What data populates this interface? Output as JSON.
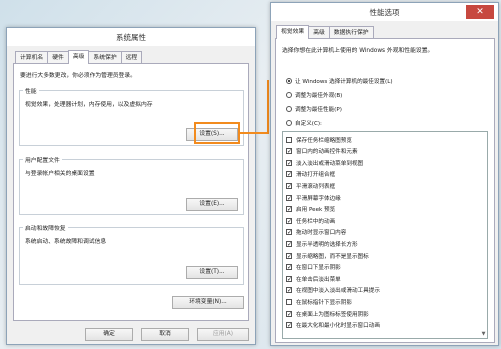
{
  "left_window": {
    "title": "系统属性",
    "tabs": [
      "计算机名",
      "硬件",
      "高级",
      "系统保护",
      "远程"
    ],
    "active_tab": "高级",
    "notice": "要进行大多数更改，你必须作为管理员登录。",
    "performance": {
      "title": "性能",
      "desc": "视觉效果，处理器计划，内存使用，以及虚拟内存",
      "button": "设置(S)..."
    },
    "user_profiles": {
      "title": "用户配置文件",
      "desc": "与登录帐户相关的桌面设置",
      "button": "设置(E)..."
    },
    "startup": {
      "title": "启动和故障恢复",
      "desc": "系统启动、系统故障和调试信息",
      "button": "设置(T)..."
    },
    "env_button": "环境变量(N)...",
    "ok": "确定",
    "cancel": "取消",
    "apply": "应用(A)"
  },
  "right_window": {
    "title": "性能选项",
    "tabs": [
      "视觉效果",
      "高级",
      "数据执行保护"
    ],
    "active_tab": "视觉效果",
    "intro": "选择你想在此计算机上使用的 Windows 外观和性能设置。",
    "radios": [
      {
        "label": "让 Windows 选择计算机的最佳设置(L)",
        "selected": true
      },
      {
        "label": "调整为最佳外观(B)",
        "selected": false
      },
      {
        "label": "调整为最佳性能(P)",
        "selected": false
      },
      {
        "label": "自定义(C):",
        "selected": false
      }
    ],
    "checks": [
      {
        "label": "保存任务栏缩略图预览",
        "checked": false
      },
      {
        "label": "窗口内的动画控件和元素",
        "checked": true
      },
      {
        "label": "淡入淡出或滑动菜单到视图",
        "checked": true
      },
      {
        "label": "滑动打开组合框",
        "checked": true
      },
      {
        "label": "平滑滚动列表框",
        "checked": true
      },
      {
        "label": "平滑屏幕字体边缘",
        "checked": true
      },
      {
        "label": "启用 Peek 预览",
        "checked": true
      },
      {
        "label": "任务栏中的动画",
        "checked": true
      },
      {
        "label": "拖动时显示窗口内容",
        "checked": true
      },
      {
        "label": "显示半透明的选择长方形",
        "checked": true
      },
      {
        "label": "显示缩略图，而不是显示图标",
        "checked": true
      },
      {
        "label": "在窗口下显示阴影",
        "checked": true
      },
      {
        "label": "在单击后淡出菜单",
        "checked": true
      },
      {
        "label": "在视图中淡入淡出或滑动工具提示",
        "checked": true
      },
      {
        "label": "在鼠标指针下显示阴影",
        "checked": false
      },
      {
        "label": "在桌面上为图标标签使用阴影",
        "checked": true
      },
      {
        "label": "在最大化和最小化时显示窗口动画",
        "checked": true
      }
    ]
  },
  "colors": {
    "highlight": "#f28b1e",
    "close": "#c7483f"
  }
}
